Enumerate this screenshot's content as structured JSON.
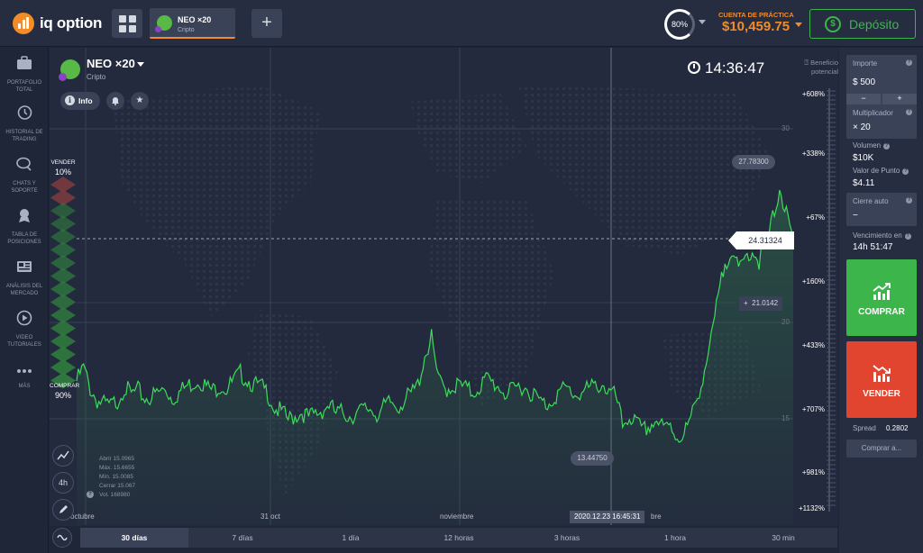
{
  "topbar": {
    "logo_text": "iq option",
    "asset_tab": {
      "name": "NEO ×20",
      "category": "Cripto"
    },
    "plus_label": "+",
    "gauge_value": "80%",
    "account_label": "CUENTA DE PRÁCTICA",
    "account_balance": "$10,459.75",
    "deposit_label": "Depósito",
    "deposit_icon": "$"
  },
  "sidebar": {
    "items": [
      {
        "label": "PORTAFOLIO TOTAL",
        "icon": "briefcase-icon"
      },
      {
        "label": "HISTORIAL DE TRADING",
        "icon": "history-icon"
      },
      {
        "label": "CHATS Y SOPORTE",
        "icon": "chat-icon"
      },
      {
        "label": "TABLA DE POSICIONES",
        "icon": "medal-icon"
      },
      {
        "label": "ANÁLISIS DEL MERCADO",
        "icon": "newspaper-icon"
      },
      {
        "label": "VIDEO TUTORIALES",
        "icon": "play-icon"
      },
      {
        "label": "MÁS",
        "icon": "more-icon"
      }
    ]
  },
  "chart_header": {
    "title": "NEO ×20",
    "subtitle": "Cripto",
    "info_label": "Info",
    "clock": "14:36:47",
    "profit_label_1": "Beneficio",
    "profit_label_2": "potencial"
  },
  "sentiment": {
    "sell_label": "VENDER",
    "sell_value": "10%",
    "sell_fraction": 0.1,
    "buy_label": "COMPRAR",
    "buy_value": "90%",
    "buy_fraction": 0.9
  },
  "profit_scale": [
    "+608%",
    "+338%",
    "+67%",
    "+160%",
    "+433%",
    "+707%",
    "+981%",
    "+1132%"
  ],
  "price_ticks": [
    "30",
    "20",
    "15"
  ],
  "labels": {
    "current_price": "24.31324",
    "high_price": "27.78300",
    "low_price": "13.44750",
    "strike_price": "21.0142",
    "strike_plus": "+",
    "crosshair_time": "2020.12.23 16:45:31"
  },
  "x_ticks": [
    "octubre",
    "31 oct",
    "noviembre",
    "bre"
  ],
  "ohlc": {
    "lines": [
      "Abrir   15.0965",
      "Máx.   15.6655",
      "Mín.   15.0085",
      "Cerrar  15.067",
      "Vol.   168980"
    ]
  },
  "tools": {
    "timeframe": "4h"
  },
  "periods": [
    "30 días",
    "7 días",
    "1 día",
    "12 horas",
    "3 horas",
    "1 hora",
    "30 min"
  ],
  "right_panel": {
    "amount_label": "Importe",
    "amount_value": "$  500",
    "minus": "−",
    "plus": "+",
    "multiplier_label": "Multiplicador",
    "multiplier_value": "× 20",
    "volume_label": "Volumen",
    "volume_value": "$10K",
    "point_value_label": "Valor de Punto",
    "point_value_value": "$4.11",
    "auto_close_label": "Cierre auto",
    "auto_close_value": "−",
    "expiry_label": "Vencimiento en",
    "expiry_value": "14h 51:47",
    "buy_label": "COMPRAR",
    "sell_label": "VENDER",
    "spread_label": "Spread",
    "spread_value": "0.2802",
    "buy_at_label": "Comprar a..."
  },
  "chart_data": {
    "type": "area",
    "title": "",
    "series": [
      {
        "values": [
          17.2,
          17.9,
          16.8,
          16.2,
          16.0,
          15.9,
          16.2,
          16.9,
          16.5,
          16.7,
          16.3,
          16.4,
          16.6,
          16.8,
          16.3,
          16.6,
          16.9,
          17.1,
          17.3,
          16.9,
          16.7,
          17.0,
          16.8,
          17.2,
          17.6,
          17.3,
          17.0,
          16.9,
          16.6,
          15.8,
          15.6,
          15.2,
          15.4,
          15.6,
          15.3,
          15.5,
          15.7,
          16.0,
          15.5,
          15.6,
          15.4,
          15.5,
          15.7,
          15.8,
          15.5,
          15.8,
          16.1,
          15.9,
          16.2,
          16.5,
          17.0,
          18.5,
          19.4,
          17.2,
          16.8,
          16.9,
          17.0,
          16.8,
          16.6,
          16.9,
          17.3,
          17.1,
          16.9,
          16.5,
          16.7,
          17.0,
          16.8,
          16.5,
          16.1,
          16.0,
          16.4,
          16.7,
          16.8,
          16.5,
          16.6,
          16.8,
          16.9,
          17.1,
          16.6,
          16.4,
          14.9,
          15.4,
          15.0,
          14.6,
          14.9,
          15.2,
          14.7,
          14.9,
          14.3,
          14.5,
          15.2,
          16.4,
          17.8,
          19.3,
          21.5,
          23.3,
          24.1,
          22.8,
          23.6,
          24.0,
          23.4,
          24.2,
          25.6,
          27.2,
          25.8,
          24.3
        ],
        "x_start": "octubre",
        "high": 27.783,
        "low": 13.4475,
        "current": 24.31324
      }
    ],
    "ylim": [
      12,
      32
    ],
    "x_ticks": [
      "octubre",
      "31 oct",
      "noviembre",
      "bre"
    ]
  }
}
